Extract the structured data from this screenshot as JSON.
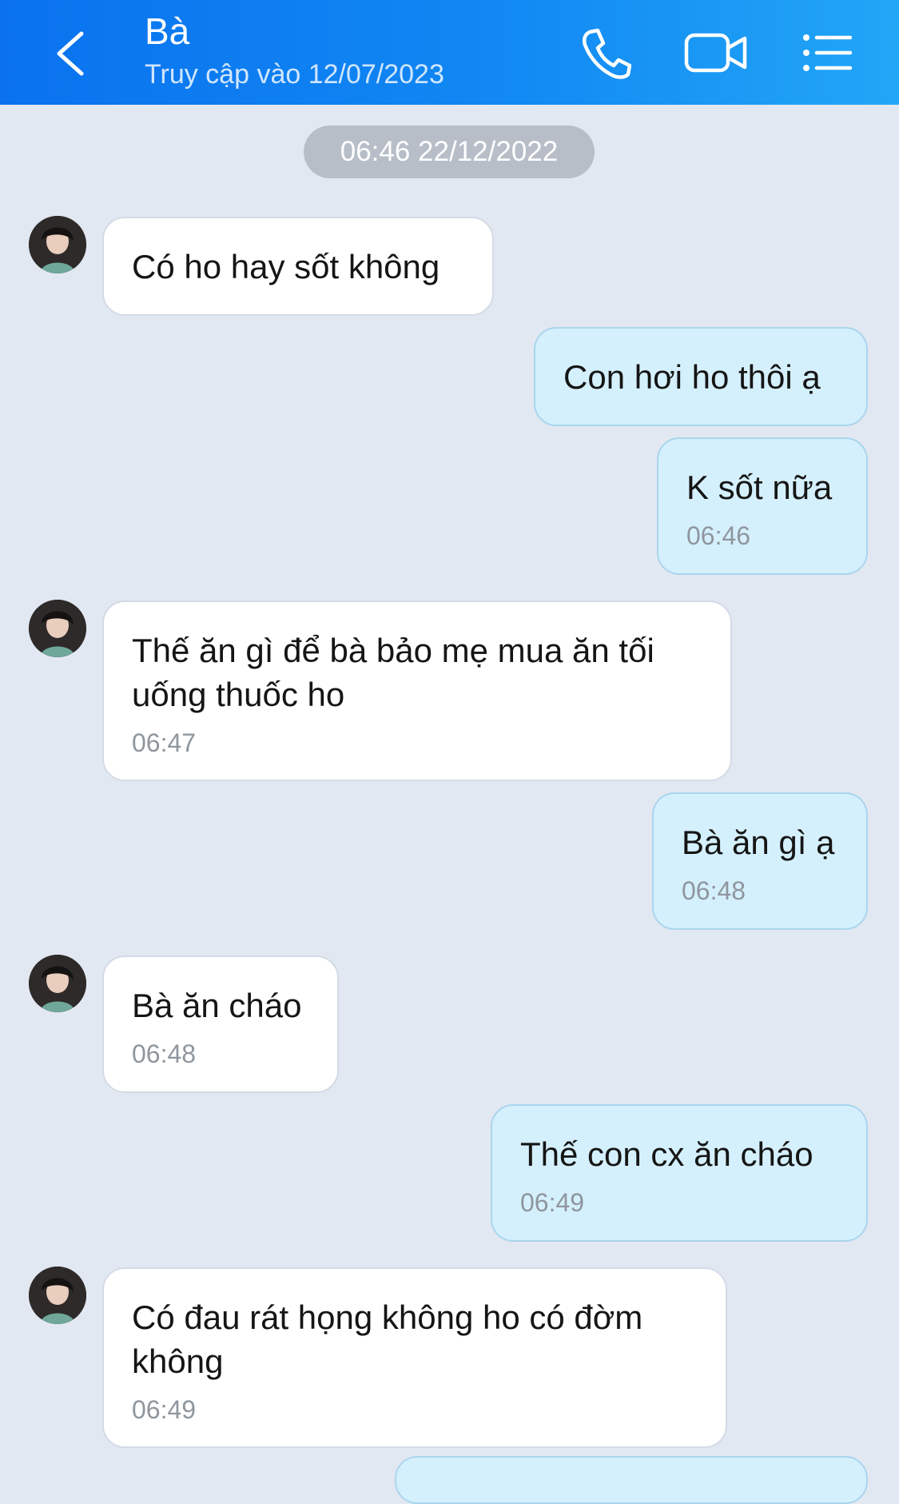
{
  "header": {
    "title": "Bà",
    "subtitle": "Truy cập vào 12/07/2023",
    "icons": [
      "back-icon",
      "phone-icon",
      "video-call-icon",
      "menu-list-icon"
    ],
    "colors": {
      "gradient_start": "#0a72ee",
      "gradient_end": "#22a6f6"
    }
  },
  "chat": {
    "date_separator": "06:46 22/12/2022",
    "messages": [
      {
        "from": "contact",
        "lines": [
          "Có ho hay sốt không"
        ],
        "time": ""
      },
      {
        "from": "me",
        "lines": [
          "Con hơi ho thôi ạ"
        ],
        "time": ""
      },
      {
        "from": "me",
        "lines": [
          "K sốt nữa"
        ],
        "time": "06:46"
      },
      {
        "from": "contact",
        "lines": [
          "Thế ăn gì để bà bảo mẹ mua ăn tối",
          "uống thuốc ho"
        ],
        "time": "06:47"
      },
      {
        "from": "me",
        "lines": [
          "Bà ăn gì ạ"
        ],
        "time": "06:48"
      },
      {
        "from": "contact",
        "lines": [
          "Bà ăn cháo"
        ],
        "time": "06:48"
      },
      {
        "from": "me",
        "lines": [
          "Thế con cx ăn cháo"
        ],
        "time": "06:49"
      },
      {
        "from": "contact",
        "lines": [
          "Có đau rát họng không ho có đờm",
          "không"
        ],
        "time": "06:49"
      }
    ]
  }
}
